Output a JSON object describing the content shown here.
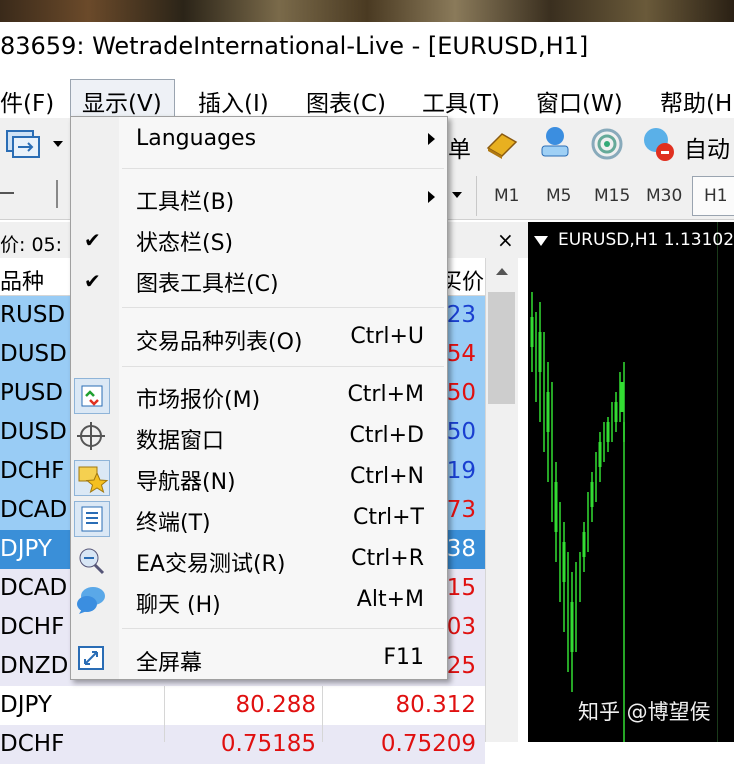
{
  "window": {
    "title": "83659: WetradeInternational-Live - [EURUSD,H1]"
  },
  "menu": [
    {
      "label": "件(F)"
    },
    {
      "label": "显示(V)"
    },
    {
      "label": "插入(I)"
    },
    {
      "label": "图表(C)"
    },
    {
      "label": "工具(T)"
    },
    {
      "label": "窗口(W)"
    },
    {
      "label": "帮助(H)"
    }
  ],
  "toolbar": {
    "partial_label": "单",
    "auto_label": "自动",
    "timeframes": [
      "M1",
      "M5",
      "M15",
      "M30",
      "H1"
    ]
  },
  "market_watch": {
    "header_label": "价: 05:",
    "close_symbol": "×",
    "col_symbol": "品种",
    "col_ask": "买价",
    "rows": [
      {
        "symbol": "RUSD",
        "ask": "23"
      },
      {
        "symbol": "DUSD",
        "ask": "54"
      },
      {
        "symbol": "PUSD",
        "ask": "50"
      },
      {
        "symbol": "DUSD",
        "ask": "50"
      },
      {
        "symbol": "DCHF",
        "ask": "19"
      },
      {
        "symbol": "DCAD",
        "ask": "73"
      },
      {
        "symbol": "DJPY",
        "ask": "38"
      },
      {
        "symbol": "DCAD",
        "ask": "15"
      },
      {
        "symbol": "DCHF",
        "ask": "03"
      },
      {
        "symbol": "DNZD",
        "ask": "25"
      },
      {
        "symbol": "DJPY",
        "bid": "80.288",
        "ask": "80.312"
      },
      {
        "symbol": "DCHF",
        "bid": "0.75185",
        "ask": "0.75209"
      }
    ]
  },
  "chart": {
    "title": "EURUSD,H1  1.13102"
  },
  "watermark": "知乎 @博望侯",
  "dropdown": {
    "items": [
      {
        "label": "Languages"
      },
      {
        "label": "工具栏(B)"
      },
      {
        "label": "状态栏(S)",
        "checked": "✔"
      },
      {
        "label": "图表工具栏(C)",
        "checked": "✔"
      },
      {
        "label": "交易品种列表(O)",
        "shortcut": "Ctrl+U"
      },
      {
        "label": "市场报价(M)",
        "shortcut": "Ctrl+M"
      },
      {
        "label": "数据窗口",
        "shortcut": "Ctrl+D"
      },
      {
        "label": "导航器(N)",
        "shortcut": "Ctrl+N"
      },
      {
        "label": "终端(T)",
        "shortcut": "Ctrl+T"
      },
      {
        "label": "EA交易测试(R)",
        "shortcut": "Ctrl+R"
      },
      {
        "label": "聊天 (H)",
        "shortcut": "Alt+M"
      },
      {
        "label": "全屏幕",
        "shortcut": "F11"
      }
    ]
  },
  "colors": {
    "accent_blue": "#99ccf5",
    "selected_row": "#3a8fd8",
    "row_alt": "#e9e8f5",
    "price_blue": "#1a3fd0",
    "price_red": "#e01010",
    "chart_bg": "#000000",
    "candle": "#33dd33"
  }
}
